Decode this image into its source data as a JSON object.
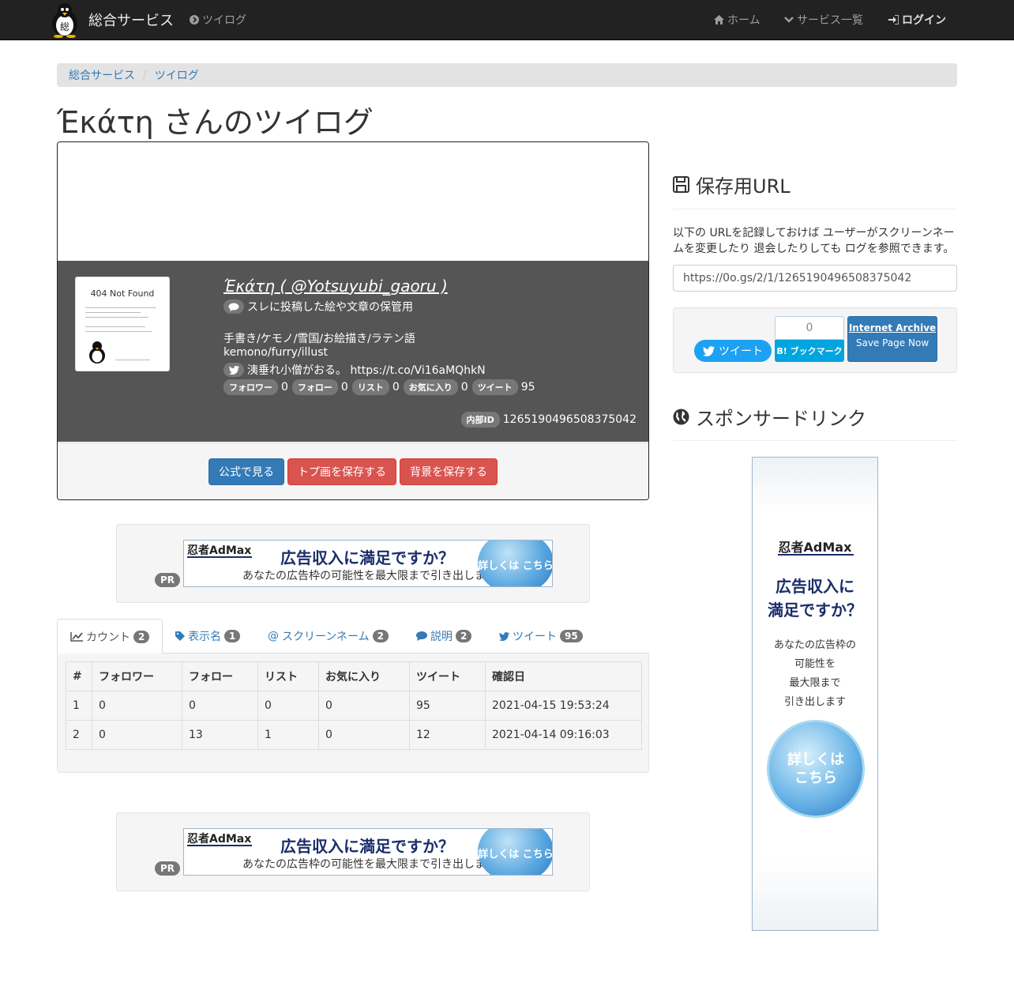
{
  "navbar": {
    "brand": "総合サービス",
    "brand_logo_char": "総",
    "app_link": "ツイログ",
    "home": "ホーム",
    "services": "サービス一覧",
    "login": "ログイン"
  },
  "breadcrumb": [
    "総合サービス",
    "ツイログ"
  ],
  "page_title": "Έκάτη さんのツイログ",
  "profile": {
    "avatar_text": "404 Not Found",
    "name": "Έκάτη ( @Yotsuyubi_gaoru )",
    "bio_line1": "スレに投稿した絵や文章の保管用",
    "bio_line2": "手書き/ケモノ/雪国/お絵描き/ラテン語",
    "bio_line3": "kemono/furry/illust",
    "tweet_line": "洟垂れ小僧がおる。 https://t.co/Vi16aMQhkN",
    "stats": {
      "followers_label": "フォロワー",
      "followers": "0",
      "following_label": "フォロー",
      "following": "0",
      "lists_label": "リスト",
      "lists": "0",
      "favorites_label": "お気に入り",
      "favorites": "0",
      "tweets_label": "ツイート",
      "tweets": "95"
    },
    "internal_id_label": "内部ID",
    "internal_id": "1265190496508375042",
    "buttons": {
      "official": "公式で見る",
      "save_avatar": "トプ画を保存する",
      "save_background": "背景を保存する"
    }
  },
  "ad_banner": {
    "brand": "忍者AdMax",
    "headline": "広告収入に満足ですか？",
    "sub": "あなたの広告枠の可能性を最大限まで引き出します",
    "cta": "詳しくは こちら",
    "pr": "PR"
  },
  "tabs": [
    {
      "label": "カウント",
      "badge": "2"
    },
    {
      "label": "表示名",
      "badge": "1"
    },
    {
      "label": "スクリーンネーム",
      "badge": "2"
    },
    {
      "label": "説明",
      "badge": "2"
    },
    {
      "label": "ツイート",
      "badge": "95"
    }
  ],
  "table": {
    "headers": [
      "#",
      "フォロワー",
      "フォロー",
      "リスト",
      "お気に入り",
      "ツイート",
      "確認日"
    ],
    "rows": [
      [
        "1",
        "0",
        "0",
        "0",
        "0",
        "95",
        "2021-04-15 19:53:24"
      ],
      [
        "2",
        "0",
        "13",
        "1",
        "0",
        "12",
        "2021-04-14 09:16:03"
      ]
    ]
  },
  "sidebar": {
    "save_url_title": "保存用URL",
    "save_url_text": "以下の URLを記録しておけば ユーザーがスクリーンネームを変更したり 退会したりしても ログを参照できます。",
    "save_url_value": "https://0o.gs/2/1/1265190496508375042",
    "tweet_button": "ツイート",
    "hatena_count": "0",
    "hatena_button": "B! ブックマーク",
    "archive_title": "Internet Archive",
    "archive_sub": "Save Page Now",
    "sponsor_title": "スポンサードリンク",
    "side_ad": {
      "brand": "忍者AdMax",
      "headline_1": "広告収入に",
      "headline_2": "満足ですか？",
      "sub_1": "あなたの広告枠の",
      "sub_2": "可能性を",
      "sub_3": "最大限まで",
      "sub_4": "引き出します",
      "cta_1": "詳しくは",
      "cta_2": "こちら"
    }
  },
  "colors": {
    "navbar_bg": "#222222",
    "link": "#337ab7",
    "danger": "#d9534f",
    "profile_dark": "#555555",
    "badge": "#777777"
  }
}
